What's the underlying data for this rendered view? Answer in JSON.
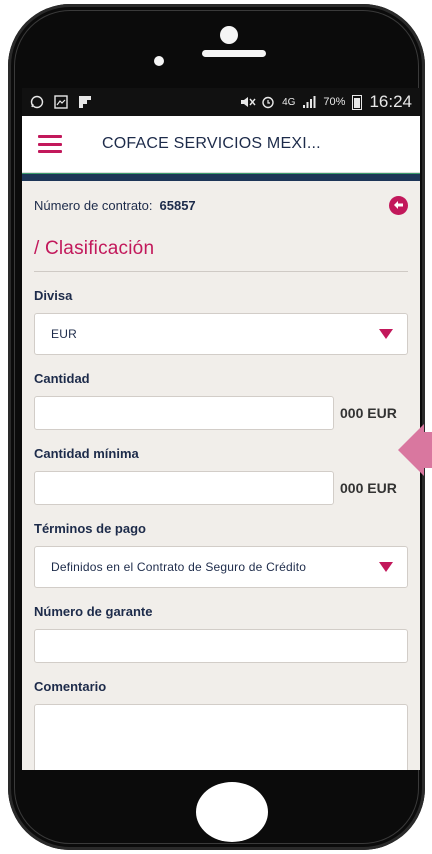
{
  "status_bar": {
    "time": "16:24",
    "battery": "70%",
    "network": "4G"
  },
  "app_bar": {
    "title": "COFACE SERVICIOS MEXI..."
  },
  "contract": {
    "label": "Número de contrato:",
    "number": "65857"
  },
  "section": {
    "title": "/ Clasificación"
  },
  "form": {
    "divisa": {
      "label": "Divisa",
      "value": "EUR"
    },
    "cantidad": {
      "label": "Cantidad",
      "value": "",
      "suffix": "000 EUR"
    },
    "cantidad_minima": {
      "label": "Cantidad mínima",
      "value": "",
      "suffix": "000 EUR"
    },
    "terminos_pago": {
      "label": "Términos de pago",
      "value": "Definidos en el Contrato de Seguro de Crédito"
    },
    "numero_garante": {
      "label": "Número de garante",
      "value": ""
    },
    "comentario": {
      "label": "Comentario",
      "value": ""
    }
  },
  "colors": {
    "accent": "#c2185b",
    "navy": "#1d2b4a",
    "background": "#f1eeea"
  }
}
